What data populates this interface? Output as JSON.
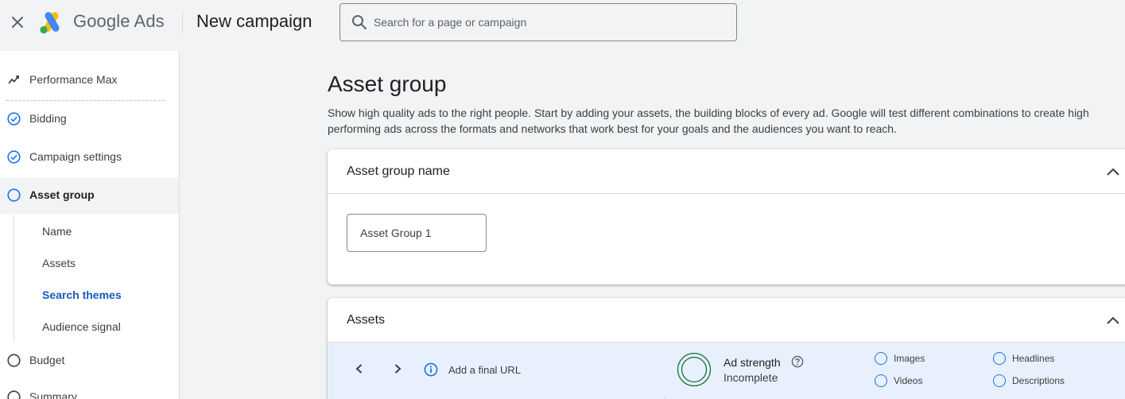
{
  "header": {
    "brand": "Google Ads",
    "page_title": "New campaign",
    "search_placeholder": "Search for a page or campaign"
  },
  "sidebar": {
    "items": [
      {
        "label": "Performance Max",
        "icon": "campaign-type-icon"
      },
      {
        "label": "Bidding",
        "icon": "check-circle-icon",
        "status": "complete"
      },
      {
        "label": "Campaign settings",
        "icon": "check-circle-icon",
        "status": "complete"
      },
      {
        "label": "Asset group",
        "icon": "empty-circle-icon",
        "status": "current"
      },
      {
        "label": "Budget",
        "icon": "empty-circle-icon",
        "status": "incomplete"
      },
      {
        "label": "Summary",
        "icon": "empty-circle-icon",
        "status": "incomplete"
      }
    ],
    "sub_items": [
      {
        "label": "Name"
      },
      {
        "label": "Assets"
      },
      {
        "label": "Search themes",
        "current": true
      },
      {
        "label": "Audience signal"
      }
    ]
  },
  "main": {
    "title": "Asset group",
    "description": "Show high quality ads to the right people. Start by adding your assets, the building blocks of every ad. Google will test different combinations to create high performing ads across the formats and networks that work best for your goals and the audiences you want to reach.",
    "name_card": {
      "title": "Asset group name",
      "input_value": "Asset Group 1"
    },
    "assets_card": {
      "title": "Assets",
      "final_url_label": "Add a final URL",
      "ad_strength_label": "Ad strength",
      "ad_strength_status": "Incomplete",
      "requirements": [
        "Images",
        "Headlines",
        "Videos",
        "Descriptions"
      ]
    }
  },
  "colors": {
    "accent": "#1a73e8",
    "sidebar_active_bg": "#f1f3f4",
    "assets_bar_bg": "#e8f0fe"
  }
}
